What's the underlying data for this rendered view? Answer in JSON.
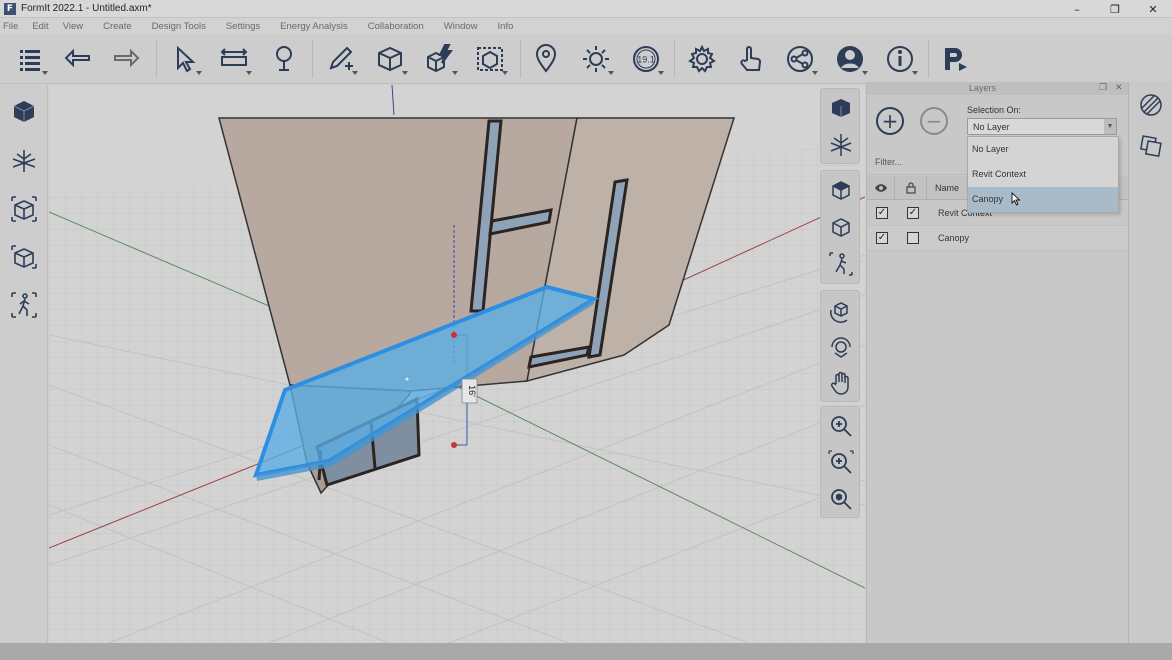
{
  "window": {
    "title": "FormIt 2022.1 - Untitled.axm*",
    "logo_letter": "F",
    "minimize": "–",
    "maximize": "❐",
    "close": "✕"
  },
  "menu": [
    "File",
    "Edit",
    "View",
    "Create",
    "Design Tools",
    "Settings",
    "Energy Analysis",
    "Collaboration",
    "Window",
    "Info"
  ],
  "toolbar": {
    "icons": [
      "main-menu-icon",
      "undo-icon",
      "redo-icon",
      "select-icon",
      "dimension-icon",
      "tape-measure-icon",
      "sketch-icon",
      "primitives-icon",
      "quick-tools-icon",
      "groups-icon",
      "location-icon",
      "sun-icon",
      "version-badge-icon",
      "settings-icon",
      "touch-icon",
      "share-icon",
      "account-icon",
      "info-icon",
      "revit-plugin-icon"
    ],
    "version_badge": "19.1"
  },
  "left_tools": [
    "view-cube-icon",
    "axes-view-icon",
    "perspective-box-icon",
    "orbit-box-icon",
    "walk-icon"
  ],
  "viewport": {
    "dimension_label": "16'",
    "accent_color": "#3ea0e2"
  },
  "nav_tools": [
    "home-view-icon",
    "sections-icon",
    "front-view-icon",
    "iso-view-icon",
    "walk-view-icon",
    "orbit-icon",
    "pan-orbit-icon",
    "pan-hand-icon",
    "zoom-icon",
    "zoom-window-icon",
    "zoom-extents-icon"
  ],
  "layers_panel": {
    "title": "Layers",
    "add_label": "+",
    "remove_label": "−",
    "selection_on_label": "Selection On:",
    "selection_value": "No Layer",
    "dropdown_arrow": "▼",
    "dropdown_options": [
      "No Layer",
      "Revit Context",
      "Canopy"
    ],
    "dropdown_selected": "Canopy",
    "filter_placeholder": "Filter...",
    "column_name": "Name",
    "rows": [
      {
        "name": "Revit Context",
        "visible": true,
        "locked": true
      },
      {
        "name": "Canopy",
        "visible": true,
        "locked": false
      }
    ]
  },
  "far_right_tools": [
    "materials-icon",
    "layers-stack-icon"
  ]
}
